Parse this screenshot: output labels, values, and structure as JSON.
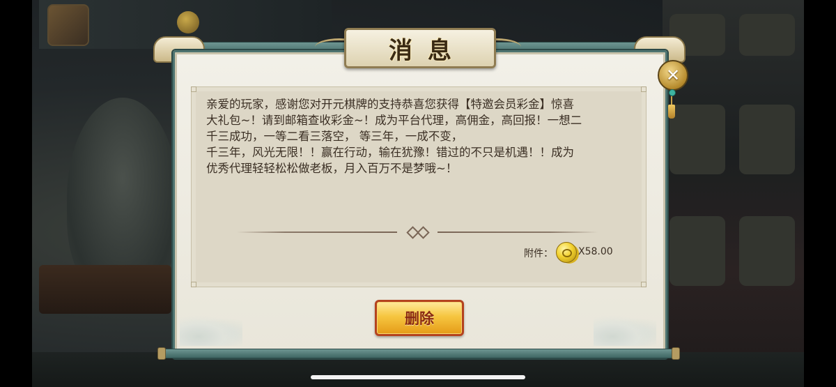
{
  "dialog": {
    "title": "消息",
    "message": "亲爱的玩家，感谢您对开元棋牌的支持恭喜您获得【特邀会员彩金】惊喜\n大礼包~！请到邮箱查收彩金~！成为平台代理，高佣金，高回报！一想二\n千三成功，一等二看三落空， 等三年，一成不变，\n千三年，风光无限！！赢在行动，输在犹豫！错过的不只是机遇！！成为\n优秀代理轻轻松松做老板，月入百万不是梦哦~！",
    "attachment_label": "附件：",
    "attachment_amount": "X58.00",
    "delete_label": "删除",
    "close_icon": "close-icon",
    "colors": {
      "frame": "#4d7370",
      "button": "#f6c640",
      "button_text": "#8a2a12"
    }
  }
}
